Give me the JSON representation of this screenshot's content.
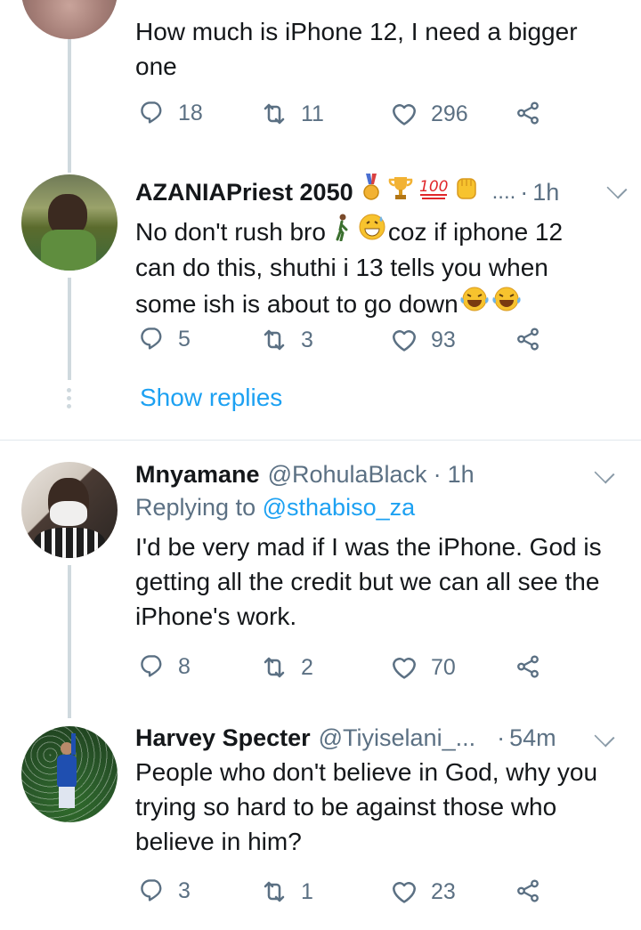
{
  "tweets": [
    {
      "text": "How much is iPhone 12, I need a bigger one",
      "replies": "18",
      "retweets": "11",
      "likes": "296"
    },
    {
      "name": "AZANIAPriest 2050",
      "handle_trunc": "....",
      "sep": "·",
      "time": "1h",
      "text_1": "No don't rush bro",
      "text_2": "coz if iphone 12",
      "text_3": "can do this, shuthi i 13 tells you when",
      "text_4": "some ish is about to go down",
      "replies": "5",
      "retweets": "3",
      "likes": "93",
      "show_replies": "Show replies"
    },
    {
      "name": "Mnyamane",
      "handle": "@RohulaBlack",
      "sep": "·",
      "time": "1h",
      "replying_prefix": "Replying to",
      "replying_to": "@sthabiso_za",
      "text": "I'd be very mad if I was the iPhone. God is getting all the credit but we can all see the iPhone's work.",
      "replies": "8",
      "retweets": "2",
      "likes": "70"
    },
    {
      "name": "Harvey Specter",
      "handle": "@Tiyiselani_...",
      "sep": "·",
      "time": "54m",
      "text": "People who don't believe in God, why you trying so hard to be against those who believe in him?",
      "replies": "3",
      "retweets": "1",
      "likes": "23"
    }
  ],
  "icons": {
    "reply": "reply-icon",
    "retweet": "retweet-icon",
    "like": "like-icon",
    "share": "share-icon",
    "caret": "chevron-down-icon"
  },
  "colors": {
    "link": "#1da1f2",
    "muted": "#5b7083",
    "text": "#14171a",
    "line": "#cfd9de"
  }
}
